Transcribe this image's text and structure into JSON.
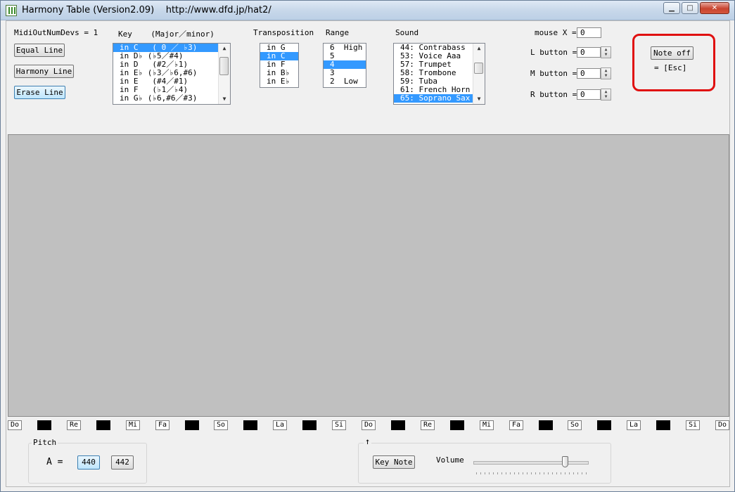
{
  "window": {
    "title": "Harmony Table (Version2.09)    http://www.dfd.jp/hat2/",
    "minimize": "▁",
    "maximize": "□",
    "close": "✕"
  },
  "midi_label": "MidiOutNumDevs = 1",
  "buttons": {
    "equal": "Equal Line",
    "harmony": "Harmony Line",
    "erase": "Erase Line",
    "note_off": "Note off",
    "key_note": "Key Note"
  },
  "note_off_hint": "= [Esc]",
  "key": {
    "header": "Key    (Major／minor)",
    "items": [
      {
        "text": "in C   ( 0 ／ ♭3)",
        "selected": true
      },
      {
        "text": "in D♭ (♭5／#4)",
        "selected": false
      },
      {
        "text": "in D   (#2／♭1)",
        "selected": false
      },
      {
        "text": "in E♭ (♭3／♭6,#6)",
        "selected": false
      },
      {
        "text": "in E   (#4／#1)",
        "selected": false
      },
      {
        "text": "in F   (♭1／♭4)",
        "selected": false
      },
      {
        "text": "in G♭ (♭6,#6／#3)",
        "selected": false
      }
    ]
  },
  "transposition": {
    "header": "Transposition",
    "items": [
      {
        "text": "in G",
        "selected": false
      },
      {
        "text": "in C",
        "selected": true
      },
      {
        "text": "in F",
        "selected": false
      },
      {
        "text": "in B♭",
        "selected": false
      },
      {
        "text": "in E♭",
        "selected": false
      }
    ]
  },
  "range": {
    "header": "Range",
    "items": [
      {
        "text": "6  High",
        "selected": false
      },
      {
        "text": "5",
        "selected": false
      },
      {
        "text": "4",
        "selected": true
      },
      {
        "text": "3",
        "selected": false
      },
      {
        "text": "2  Low",
        "selected": false
      }
    ]
  },
  "sound": {
    "header": "Sound",
    "items": [
      {
        "text": "44: Contrabass",
        "selected": false
      },
      {
        "text": "53: Voice Aaa",
        "selected": false
      },
      {
        "text": "57: Trumpet",
        "selected": false
      },
      {
        "text": "58: Trombone",
        "selected": false
      },
      {
        "text": "59: Tuba",
        "selected": false
      },
      {
        "text": "61: French Horn",
        "selected": false
      },
      {
        "text": "65: Soprano Sax",
        "selected": true
      }
    ]
  },
  "mouse": {
    "x_label": "mouse X =",
    "x_value": "0",
    "l_label": "L button =",
    "l_value": "0",
    "m_label": "M button =",
    "m_value": "0",
    "r_label": "R button =",
    "r_value": "0"
  },
  "keyboard": {
    "keys": [
      "Do",
      "",
      "Re",
      "",
      "Mi",
      "Fa",
      "",
      "So",
      "",
      "La",
      "",
      "Si",
      "Do",
      "",
      "Re",
      "",
      "Mi",
      "Fa",
      "",
      "So",
      "",
      "La",
      "",
      "Si",
      "Do"
    ]
  },
  "pitch": {
    "group_label": "Pitch",
    "a_label": "A =",
    "opt1": "440",
    "opt2": "442",
    "selected": "440"
  },
  "volume": {
    "arrow": "↑",
    "label": "Volume",
    "level_percent": 80
  }
}
